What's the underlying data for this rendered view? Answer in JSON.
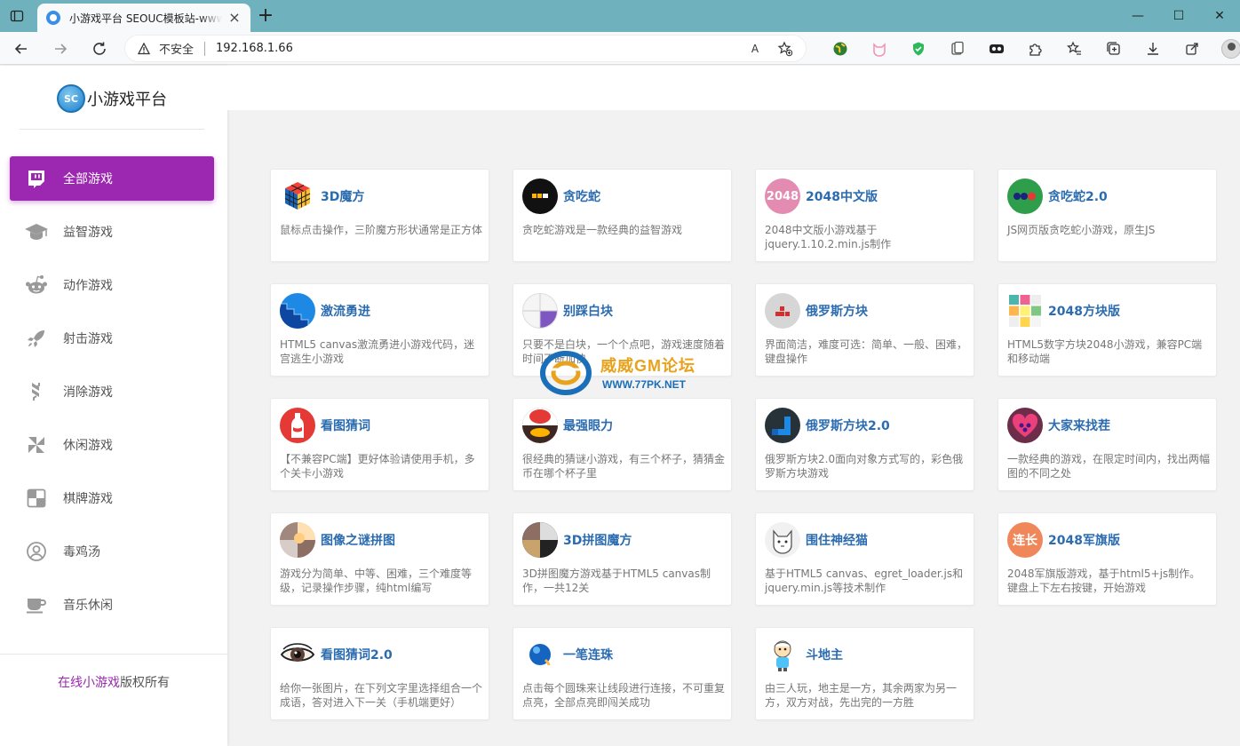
{
  "browser": {
    "tab_title": "小游戏平台 SEOUC模板站-www.seouc.com",
    "tab_close": "×",
    "new_tab": "+",
    "window_controls": {
      "minimize": "—",
      "maximize": "☐",
      "close": "✕"
    },
    "security_label": "不安全",
    "url": "192.168.1.66",
    "read_aloud": "A"
  },
  "site": {
    "logo_badge": "SC",
    "name": "小游戏平台"
  },
  "sidebar": {
    "items": [
      {
        "label": "全部游戏",
        "icon": "twitch-icon",
        "active": true
      },
      {
        "label": "益智游戏",
        "icon": "graduation-cap-icon",
        "active": false
      },
      {
        "label": "动作游戏",
        "icon": "reddit-icon",
        "active": false
      },
      {
        "label": "射击游戏",
        "icon": "rocket-icon",
        "active": false
      },
      {
        "label": "消除游戏",
        "icon": "stack-icon",
        "active": false
      },
      {
        "label": "休闲游戏",
        "icon": "pinwheel-icon",
        "active": false
      },
      {
        "label": "棋牌游戏",
        "icon": "board-icon",
        "active": false
      },
      {
        "label": "毒鸡汤",
        "icon": "user-circle-icon",
        "active": false
      },
      {
        "label": "音乐休闲",
        "icon": "coffee-cup-icon",
        "active": false
      }
    ],
    "footer_link": "在线小游戏",
    "footer_text": "版权所有"
  },
  "games": [
    {
      "title": "3D魔方",
      "desc": "鼠标点击操作，三阶魔方形状通常是正方体",
      "icon": "rubiks-cube-icon"
    },
    {
      "title": "贪吃蛇",
      "desc": "贪吃蛇游戏是一款经典的益智游戏",
      "icon": "snake-icon"
    },
    {
      "title": "2048中文版",
      "desc": "2048中文版小游戏基于jquery.1.10.2.min.js制作",
      "icon": "tile-2048-icon",
      "badge": "2048"
    },
    {
      "title": "贪吃蛇2.0",
      "desc": "JS网页版贪吃蛇小游戏，原生JS",
      "icon": "snake-dots-icon"
    },
    {
      "title": "激流勇进",
      "desc": "HTML5 canvas激流勇进小游戏代码，迷宫逃生小游戏",
      "icon": "maze-stairs-icon"
    },
    {
      "title": "别踩白块",
      "desc": "只要不是白块，一个个点吧，游戏速度随着时间不断加快",
      "icon": "piano-tiles-icon"
    },
    {
      "title": "俄罗斯方块",
      "desc": "界面简洁，难度可选：简单、一般、困难，键盘操作",
      "icon": "tetris-icon"
    },
    {
      "title": "2048方块版",
      "desc": "HTML5数字方块2048小游戏，兼容PC端和移动端",
      "icon": "color-grid-icon"
    },
    {
      "title": "看图猜词",
      "desc": "【不兼容PC端】更好体验请使用手机，多个关卡小游戏",
      "icon": "bottle-icon"
    },
    {
      "title": "最强眼力",
      "desc": "很经典的猜谜小游戏，有三个杯子，猜猜金币在哪个杯子里",
      "icon": "cup-coin-icon"
    },
    {
      "title": "俄罗斯方块2.0",
      "desc": "俄罗斯方块2.0面向对象方式写的，彩色俄罗斯方块游戏",
      "icon": "tetris-blue-icon"
    },
    {
      "title": "大家来找茬",
      "desc": "一款经典的游戏，在限定时间内，找出两幅图的不同之处",
      "icon": "heart-icon"
    },
    {
      "title": "图像之谜拼图",
      "desc": "游戏分为简单、中等、困难，三个难度等级，记录操作步骤，纯html编写",
      "icon": "photo-puzzle-icon"
    },
    {
      "title": "3D拼图魔方",
      "desc": "3D拼图魔方游戏基于HTML5 canvas制作，一共12关",
      "icon": "puzzle-cube-icon"
    },
    {
      "title": "围住神经猫",
      "desc": "基于HTML5 canvas、egret_loader.js和jquery.min.js等技术制作",
      "icon": "cat-icon"
    },
    {
      "title": "2048军旗版",
      "desc": "2048军旗版游戏，基于html5+js制作。键盘上下左右按键，开始游戏",
      "icon": "badge-text-icon",
      "badge": "连长"
    },
    {
      "title": "看图猜词2.0",
      "desc": "给你一张图片，在下列文字里选择组合一个成语，答对进入下一关（手机端更好）",
      "icon": "eye-icon"
    },
    {
      "title": "一笔连珠",
      "desc": "点击每个圆珠来让线段进行连接，不可重复点亮，全部点亮即闯关成功",
      "icon": "bead-icon"
    },
    {
      "title": "斗地主",
      "desc": "由三人玩，地主是一方，其余两家为另一方，双方对战，先出完的一方胜",
      "icon": "cartoon-player-icon"
    }
  ],
  "watermark": {
    "title": "威威GM论坛",
    "url": "WWW.77PK.NET"
  },
  "colors": {
    "accent": "#9c27b0",
    "title_blue": "#2b6cb0",
    "tabbar": "#6fb2be"
  }
}
